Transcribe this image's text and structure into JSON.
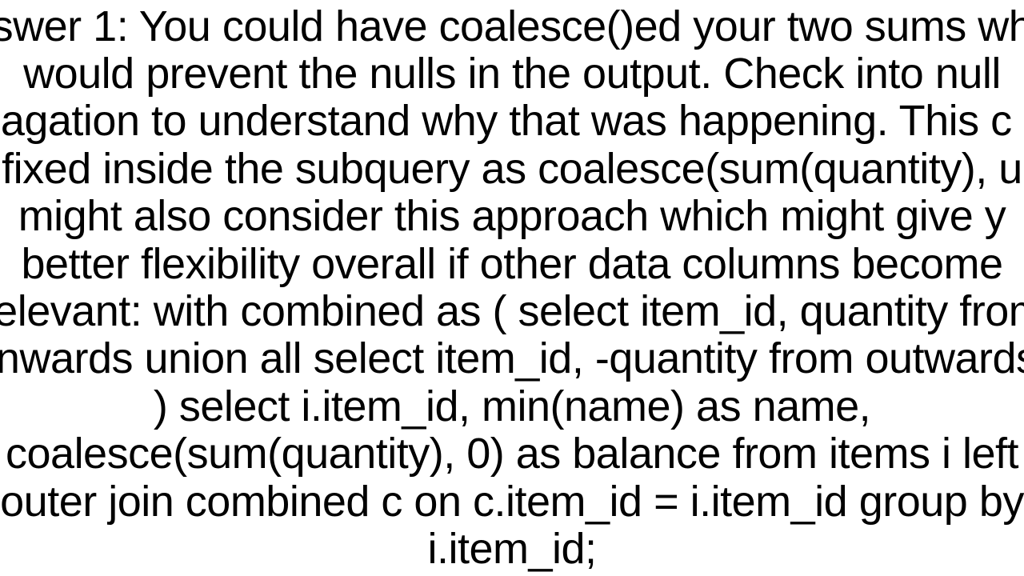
{
  "content": {
    "text": "swer 1: You could have coalesce()ed your two sums wh would prevent the nulls in the output. Check into null pagation to understand why that was happening. This c e fixed inside the subquery as coalesce(sum(quantity), u might also consider this approach which might give y better flexibility overall if other data columns become relevant: with combined as (     select item_id,  quantity from inwards union all     select item_id, -quantity from outwards ) select i.item_id, min(name) as name, coalesce(sum(quantity), 0) as balance from items i left outer join combined c on c.item_id = i.item_id group by i.item_id;"
  }
}
